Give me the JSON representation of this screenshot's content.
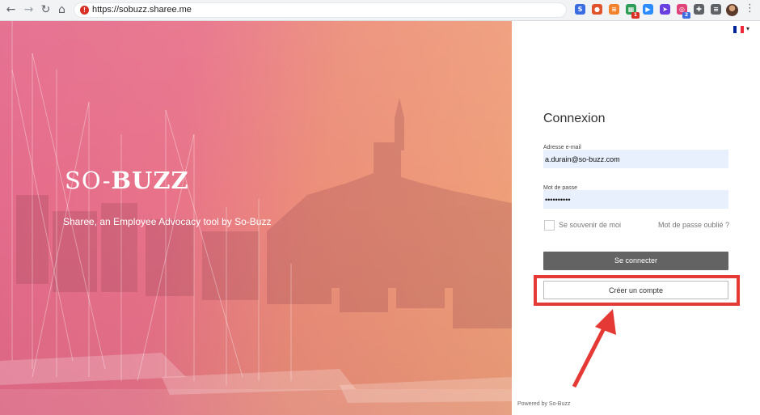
{
  "browser": {
    "url": "https://sobuzz.sharee.me",
    "nav": {
      "back": "←",
      "forward": "→",
      "reload": "↻",
      "home": "⌂"
    },
    "extensions": [
      {
        "name": "sync-icon",
        "color": "#3b6de0",
        "glyph": "S",
        "badge": ""
      },
      {
        "name": "shield-icon",
        "color": "#e0542d",
        "glyph": "●",
        "badge": ""
      },
      {
        "name": "rss-icon",
        "color": "#f2822b",
        "glyph": "≋",
        "badge": ""
      },
      {
        "name": "sheets-icon",
        "color": "#2e9d58",
        "glyph": "▦",
        "badge": "1"
      },
      {
        "name": "zoom-icon",
        "color": "#2d8cff",
        "glyph": "▶",
        "badge": ""
      },
      {
        "name": "send-icon",
        "color": "#6a3fe0",
        "glyph": "➤",
        "badge": ""
      },
      {
        "name": "target-icon",
        "color": "#e0437a",
        "glyph": "◎",
        "badge": "2"
      },
      {
        "name": "puzzle-icon",
        "color": "#5f6368",
        "glyph": "✚",
        "badge": ""
      },
      {
        "name": "queue-icon",
        "color": "#5f6368",
        "glyph": "≡",
        "badge": ""
      }
    ],
    "menu": "⋮"
  },
  "hero": {
    "logo_so": "SO-",
    "logo_buzz": "BUZZ",
    "tagline": "Sharee, an Employee Advocacy tool by So-Buzz"
  },
  "login": {
    "title": "Connexion",
    "email_label": "Adresse e-mail",
    "email_value": "a.durain@so-buzz.com",
    "password_label": "Mot de passe",
    "password_value": "••••••••••",
    "remember_label": "Se souvenir de moi",
    "forgot_label": "Mot de passe oublié ?",
    "submit_label": "Se connecter",
    "create_label": "Créer un compte",
    "powered_by": "Powered by So-Buzz"
  },
  "language": {
    "flag_colors": [
      "#002395",
      "#ffffff",
      "#ed2939"
    ],
    "caret": "▾"
  },
  "colors": {
    "highlight": "#e53935",
    "submit_bg": "#636363",
    "field_bg": "#e8f0fe"
  }
}
